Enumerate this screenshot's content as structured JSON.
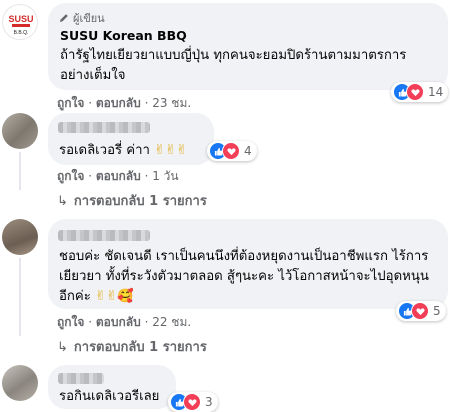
{
  "comments": [
    {
      "badge": "ผู้เขียน",
      "name": "SUSU Korean BBQ",
      "text": "ถ้ารัฐไทยเยียวยาแบบญี่ปุ่น ทุกคนจะยอมปิดร้านตามมาตรการอย่างเต็มใจ",
      "like_label": "ถูกใจ",
      "reply_label": "ตอบกลับ",
      "time": "23 ชม.",
      "reaction_count": "14"
    },
    {
      "text": "รอเดลิเวอรี่ ค่าา",
      "emojis": "✌✌✌",
      "like_label": "ถูกใจ",
      "reply_label": "ตอบกลับ",
      "time": "1 วัน",
      "reaction_count": "4",
      "replies_label": "การตอบกลับ 1 รายการ"
    },
    {
      "text": "ชอบค่ะ ชัดเจนดี เราเป็นคนนึงที่ต้องหยุดงานเป็นอาชีพแรก ไร้การเยียวยา ทั้งที่ระวังตัวมาตลอด สู้ๆนะคะ ไว้โอกาสหน้าจะไปอุดหนุนอีกค่ะ",
      "emojis": "✌✌🥰",
      "like_label": "ถูกใจ",
      "reply_label": "ตอบกลับ",
      "time": "22 ชม.",
      "reaction_count": "5",
      "replies_label": "การตอบกลับ 1 รายการ"
    },
    {
      "text": "รอกินเดลิเวอรีเลย",
      "reaction_count": "3"
    }
  ],
  "logo": {
    "line1": "SUSU",
    "line2": "B.B.Q."
  },
  "colors": {
    "bubble": "#f0f2f5",
    "meta_text": "#65676b",
    "like_blue": "#1877f2",
    "love_red": "#f33e58",
    "logo_red": "#d42a2a"
  }
}
